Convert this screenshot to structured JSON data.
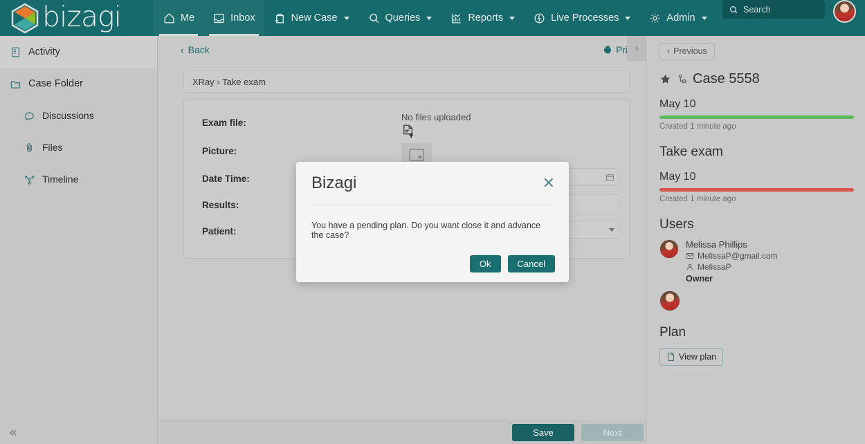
{
  "topbar": {
    "brand": "bizagi",
    "nav": [
      {
        "label": "Me",
        "icon": "home-icon",
        "caret": false,
        "active": false
      },
      {
        "label": "Inbox",
        "icon": "inbox-icon",
        "caret": false,
        "active": true
      },
      {
        "label": "New Case",
        "icon": "new-case-icon",
        "caret": true,
        "active": false
      },
      {
        "label": "Queries",
        "icon": "search-icon",
        "caret": true,
        "active": false
      },
      {
        "label": "Reports",
        "icon": "reports-icon",
        "caret": true,
        "active": false
      },
      {
        "label": "Live Processes",
        "icon": "live-processes-icon",
        "caret": true,
        "active": false
      },
      {
        "label": "Admin",
        "icon": "gear-icon",
        "caret": true,
        "active": false
      }
    ],
    "search_placeholder": "Search"
  },
  "sidebar": {
    "items": [
      {
        "label": "Activity",
        "icon": "activity-icon",
        "active": true,
        "sub": false
      },
      {
        "label": "Case Folder",
        "icon": "folder-icon",
        "active": false,
        "sub": false
      },
      {
        "label": "Discussions",
        "icon": "discussion-icon",
        "active": false,
        "sub": true
      },
      {
        "label": "Files",
        "icon": "paperclip-icon",
        "active": false,
        "sub": true
      },
      {
        "label": "Timeline",
        "icon": "timeline-icon",
        "active": false,
        "sub": true
      }
    ],
    "collapse_glyph": "«"
  },
  "main": {
    "back_label": "Back",
    "print_label": "Print",
    "expand_glyph": "›",
    "breadcrumb": "XRay › Take exam",
    "form": {
      "rows": [
        {
          "label": "Exam file:",
          "kind": "file",
          "note": "No files uploaded"
        },
        {
          "label": "Picture:",
          "kind": "picture",
          "note": ""
        },
        {
          "label": "Date Time:",
          "kind": "date",
          "value": ""
        },
        {
          "label": "Results:",
          "kind": "text",
          "value": ""
        },
        {
          "label": "Patient:",
          "kind": "select",
          "value": ""
        }
      ]
    }
  },
  "footer": {
    "save_label": "Save",
    "next_label": "Next"
  },
  "rightpanel": {
    "previous_label": "Previous",
    "case_title": "Case 5558",
    "stages": [
      {
        "date": "May 10",
        "color": "#5cb85c",
        "created": "Created 1 minute ago",
        "heading": ""
      },
      {
        "date": "May 10",
        "color": "#d9534f",
        "created": "Created 1 minute ago",
        "heading": "Take exam"
      }
    ],
    "users_heading": "Users",
    "users": [
      {
        "name": "Melissa Phillips",
        "email": "MelissaP@gmail.com",
        "username": "MelissaP",
        "role": "Owner"
      }
    ],
    "plan_heading": "Plan",
    "view_plan_label": "View plan"
  },
  "modal": {
    "title": "Bizagi",
    "message": "You have a pending plan. Do you want close it and advance the case?",
    "ok_label": "Ok",
    "cancel_label": "Cancel",
    "close_glyph": "✕"
  },
  "colors": {
    "brand_teal": "#176a6b",
    "accent_green": "#5cb85c",
    "accent_red": "#d9534f",
    "button_teal": "#1a6164"
  }
}
